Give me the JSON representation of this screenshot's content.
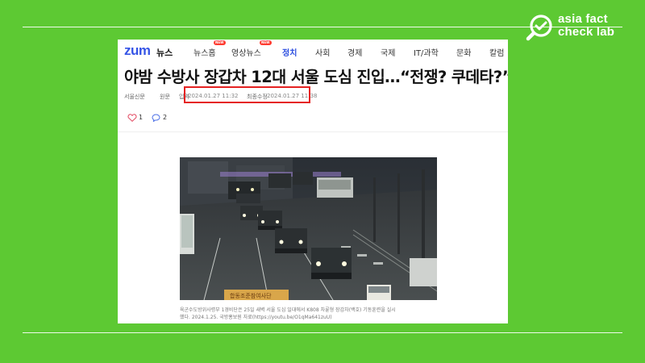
{
  "brand": {
    "line1": "asia fact",
    "line2": "check lab",
    "color": "#ffffff",
    "icon": "magnifier-check-icon"
  },
  "screenshot": {
    "site": {
      "logo": "zum",
      "section": "뉴스"
    },
    "nav": [
      {
        "label": "뉴스홈",
        "badge": "NEW"
      },
      {
        "label": "영상뉴스",
        "badge": "NEW"
      },
      {
        "label": "정치",
        "active": true
      },
      {
        "label": "사회"
      },
      {
        "label": "경제"
      },
      {
        "label": "국제"
      },
      {
        "label": "IT/과학"
      },
      {
        "label": "문화"
      },
      {
        "label": "칼럼"
      }
    ],
    "headline": "야밤 수방사 장갑차 12대 서울 도심 진입…“전쟁? 쿠데타?” 〈",
    "meta": {
      "source": "서울신문",
      "original": "원문",
      "input_label": "입력",
      "input_date": "2024.01.27 11:32",
      "modified_label": "최종수정",
      "modified_date": "2024.01.27 11:38"
    },
    "reactions": {
      "likes": "1",
      "comments": "2"
    },
    "photo": {
      "sign_text": "합동조준참여사단"
    },
    "caption": {
      "line1": "육군수도방위사령부 1경비단은 25일 새벽 서울 도심 일대에서 K808 차륜형 장갑차(백호) 기동훈련을 실시",
      "line2": "했다. 2024.1.25. 국방홍보원 자료(https://youtu.be/O1qMa641zuU)"
    },
    "accent": "#e52222"
  }
}
